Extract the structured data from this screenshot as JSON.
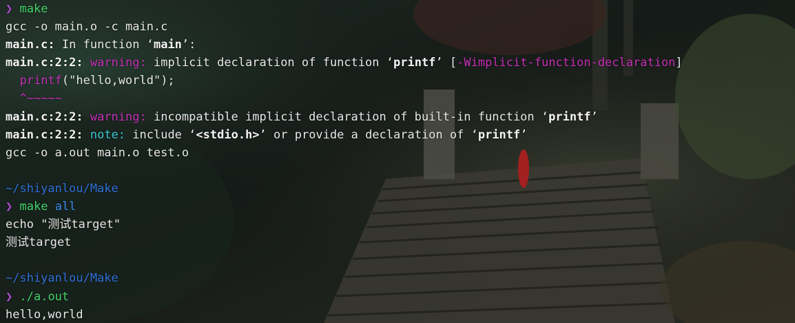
{
  "terminal": {
    "prompt_symbol": "❯",
    "lines": {
      "l1_cmd": "make",
      "l2": "gcc -o main.o -c main.c",
      "l3_file": "main.c:",
      "l3_rest": " In function ",
      "l3_quote_open": "‘",
      "l3_fn": "main",
      "l3_quote_close": "’:",
      "l4_loc": "main.c:2:2:",
      "l4_warn": "warning:",
      "l4_msg": " implicit declaration of function ",
      "l4_q1": "‘",
      "l4_fn": "printf",
      "l4_q2": "’",
      "l4_bracket_open": " [",
      "l4_flag": "-Wimplicit-function-declaration",
      "l4_bracket_close": "]",
      "l5_indent": "  ",
      "l5_fn": "printf",
      "l5_rest": "(\"hello,world\");",
      "l6_indent": "  ",
      "l6_marker": "^~~~~~",
      "l7_loc": "main.c:2:2:",
      "l7_warn": "warning:",
      "l7_msg": " incompatible implicit declaration of built-in function ",
      "l7_q1": "‘",
      "l7_fn": "printf",
      "l7_q2": "’",
      "l8_loc": "main.c:2:2:",
      "l8_note": "note:",
      "l8_msg1": " include ",
      "l8_q1": "‘",
      "l8_hdr": "<stdio.h>",
      "l8_q2": "’",
      "l8_msg2": " or provide a declaration of ",
      "l8_q3": "‘",
      "l8_fn": "printf",
      "l8_q4": "’",
      "l9": "gcc -o a.out main.o test.o",
      "l11_path": "~/shiyanlou/Make",
      "l12_cmd": "make",
      "l12_arg": "all",
      "l13": "echo \"测试target\"",
      "l14": "测试target",
      "l16_path": "~/shiyanlou/Make",
      "l17_cmd": "./a.out",
      "l18": "hello,world"
    }
  },
  "colors": {
    "prompt": "#b04fd1",
    "command": "#45d36a",
    "argument": "#3b8ef0",
    "path": "#2f6fd8",
    "warning": "#c62fb6",
    "note": "#3bc6d6",
    "text": "#e8e8e8"
  },
  "background": {
    "description_icon": "forest-temple-wallpaper"
  }
}
